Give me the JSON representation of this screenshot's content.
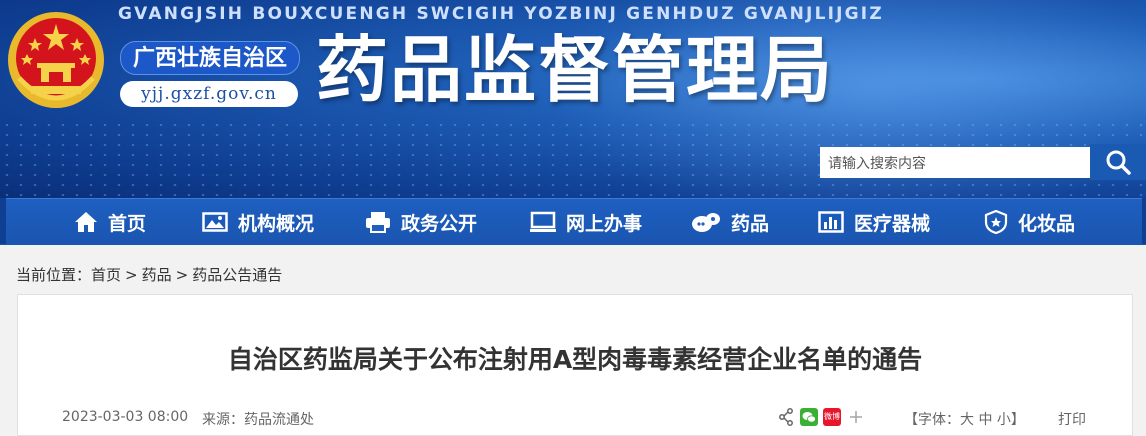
{
  "header": {
    "subtitle": "GVANGJSIH BOUXCUENGH SWCIGIH YOZBINJ GENHDUZ GVANJLIJGIZ",
    "region": "广西壮族自治区",
    "url": "yjj.gxzf.gov.cn",
    "title": "药品监督管理局",
    "search_placeholder": "请输入搜索内容"
  },
  "nav": {
    "items": [
      {
        "label": "首页",
        "icon": "home-icon"
      },
      {
        "label": "机构概况",
        "icon": "image-icon"
      },
      {
        "label": "政务公开",
        "icon": "printer-icon"
      },
      {
        "label": "网上办事",
        "icon": "monitor-icon"
      },
      {
        "label": "药品",
        "icon": "pill-icon"
      },
      {
        "label": "医疗器械",
        "icon": "chart-icon"
      },
      {
        "label": "化妆品",
        "icon": "shield-icon"
      }
    ]
  },
  "breadcrumb": {
    "prefix": "当前位置：",
    "items": [
      "首页",
      "药品",
      "药品公告通告"
    ],
    "separator": ">"
  },
  "article": {
    "title": "自治区药监局关于公布注射用A型肉毒毒素经营企业名单的通告",
    "date": "2023-03-03 08:00",
    "source": "来源：药品流通处",
    "font_size_label": "【字体：大 中 小】",
    "print_label": "打印",
    "weibo_label": "微博"
  },
  "colors": {
    "banner": "#1f5fb8",
    "nav": "#1e5fc0",
    "wechat": "#3cb034",
    "weibo": "#e6162d"
  }
}
